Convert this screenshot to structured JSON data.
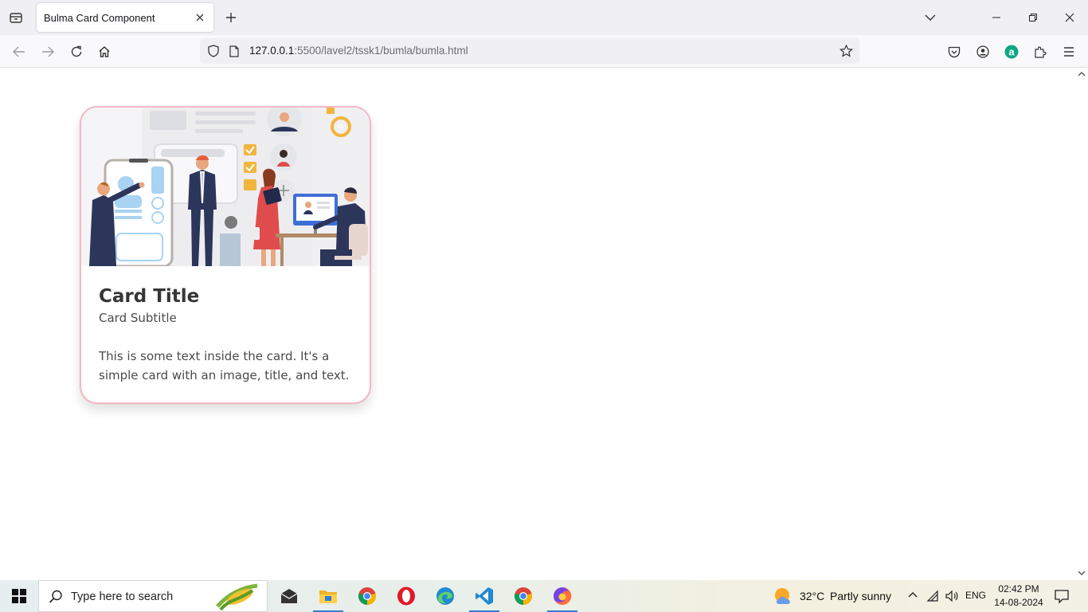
{
  "browser": {
    "tab_title": "Bulma Card Component",
    "url_host": "127.0.0.1",
    "url_rest": ":5500/lavel2/tssk1/bumla/bumla.html"
  },
  "card": {
    "title": "Card Title",
    "subtitle": "Card Subtitle",
    "text": "This is some text inside the card. It's a simple card with an image, title, and text."
  },
  "taskbar": {
    "search_placeholder": "Type here to search",
    "weather_temp": "32°C",
    "weather_desc": "Partly sunny",
    "language": "ENG",
    "time": "02:42 PM",
    "date": "14-08-2024",
    "apps": [
      "mail-app",
      "file-explorer",
      "chrome",
      "opera",
      "edge",
      "vscode",
      "chrome-profile",
      "firefox"
    ]
  },
  "colors": {
    "card_border": "#f4b8c4",
    "title_text": "#363636",
    "body_text": "#4a4a4a",
    "taskbar_accent": "#3a7bd5"
  }
}
